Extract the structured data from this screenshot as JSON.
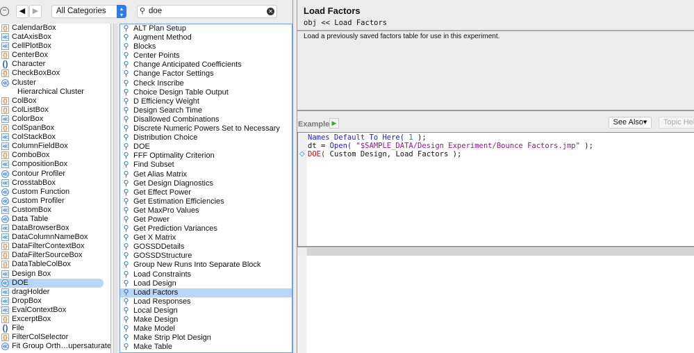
{
  "toolbar": {
    "category": "All Categories",
    "search_value": "doe"
  },
  "left_list": [
    {
      "label": "CalendarBox",
      "icon": "o"
    },
    {
      "label": "CatAxisBox",
      "icon": "b"
    },
    {
      "label": "CellPlotBox",
      "icon": "b"
    },
    {
      "label": "CenterBox",
      "icon": "o"
    },
    {
      "label": "Character",
      "icon": "p"
    },
    {
      "label": "CheckBoxBox",
      "icon": "o"
    },
    {
      "label": "Cluster",
      "icon": "c"
    },
    {
      "label": "Hierarchical Cluster",
      "icon": ""
    },
    {
      "label": "ColBox",
      "icon": "o"
    },
    {
      "label": "ColListBox",
      "icon": "o"
    },
    {
      "label": "ColorBox",
      "icon": "b"
    },
    {
      "label": "ColSpanBox",
      "icon": "o"
    },
    {
      "label": "ColStackBox",
      "icon": "b"
    },
    {
      "label": "ColumnFieldBox",
      "icon": "b"
    },
    {
      "label": "ComboBox",
      "icon": "o"
    },
    {
      "label": "CompositionBox",
      "icon": "b"
    },
    {
      "label": "Contour Profiler",
      "icon": "c"
    },
    {
      "label": "CrosstabBox",
      "icon": "b"
    },
    {
      "label": "Custom Function",
      "icon": "c"
    },
    {
      "label": "Custom Profiler",
      "icon": "c"
    },
    {
      "label": "CustomBox",
      "icon": "b"
    },
    {
      "label": "Data Table",
      "icon": "c"
    },
    {
      "label": "DataBrowserBox",
      "icon": "b"
    },
    {
      "label": "DataColumnNameBox",
      "icon": "b"
    },
    {
      "label": "DataFilterContextBox",
      "icon": "o"
    },
    {
      "label": "DataFilterSourceBox",
      "icon": "o"
    },
    {
      "label": "DataTableColBox",
      "icon": "o"
    },
    {
      "label": "Design Box",
      "icon": "b"
    },
    {
      "label": "DOE",
      "icon": "c",
      "selected": true
    },
    {
      "label": "dragHolder",
      "icon": "b"
    },
    {
      "label": "DropBox",
      "icon": "b"
    },
    {
      "label": "EvalContextBox",
      "icon": "b"
    },
    {
      "label": "ExcerptBox",
      "icon": "o"
    },
    {
      "label": "File",
      "icon": "p"
    },
    {
      "label": "FilterColSelector",
      "icon": "o"
    },
    {
      "label": "Fit Group Orth…upersaturated",
      "icon": "c"
    }
  ],
  "mid_list": [
    {
      "label": "ALT Plan Setup"
    },
    {
      "label": "Augment Method"
    },
    {
      "label": "Blocks"
    },
    {
      "label": "Center Points"
    },
    {
      "label": "Change Anticipated Coefficients"
    },
    {
      "label": "Change Factor Settings"
    },
    {
      "label": "Check Inscribe"
    },
    {
      "label": "Choice Design Table Output"
    },
    {
      "label": "D Efficiency Weight"
    },
    {
      "label": "Design Search Time"
    },
    {
      "label": "Disallowed Combinations"
    },
    {
      "label": "Discrete Numeric Powers Set to Necessary"
    },
    {
      "label": "Distribution Choice"
    },
    {
      "label": "DOE"
    },
    {
      "label": "FFF Optimality Criterion"
    },
    {
      "label": "Find Subset"
    },
    {
      "label": "Get Alias Matrix"
    },
    {
      "label": "Get Design Diagnostics"
    },
    {
      "label": "Get Effect Power"
    },
    {
      "label": "Get Estimation Efficiencies"
    },
    {
      "label": "Get MaxPro Values"
    },
    {
      "label": "Get Power"
    },
    {
      "label": "Get Prediction Variances"
    },
    {
      "label": "Get X Matrix"
    },
    {
      "label": "GOSSDDetails"
    },
    {
      "label": "GOSSDStructure"
    },
    {
      "label": "Group New Runs Into Separate Block"
    },
    {
      "label": "Load Constraints"
    },
    {
      "label": "Load Design"
    },
    {
      "label": "Load Factors",
      "selected": true
    },
    {
      "label": "Load Responses"
    },
    {
      "label": "Local Design"
    },
    {
      "label": "Make Design"
    },
    {
      "label": "Make Model"
    },
    {
      "label": "Make Strip Plot Design"
    },
    {
      "label": "Make Table"
    }
  ],
  "detail": {
    "title": "Load Factors",
    "signature": "obj << Load Factors",
    "description": "Load a previously saved factors table for use in this experiment.",
    "example_label": "Example",
    "see_also": "See Also▾",
    "topic_help": "Topic Help",
    "code": {
      "l1a": "Names Default To Here(",
      "l1b": " 1 ",
      "l1c": ");",
      "l2a": "dt = ",
      "l2b": "Open(",
      "l2c": " \"$SAMPLE_DATA/Design Experiment/Bounce Factors.jmp\" ",
      "l2d": ");",
      "l3a": "DOE(",
      "l3b": " Custom Design, Load Factors );"
    }
  }
}
